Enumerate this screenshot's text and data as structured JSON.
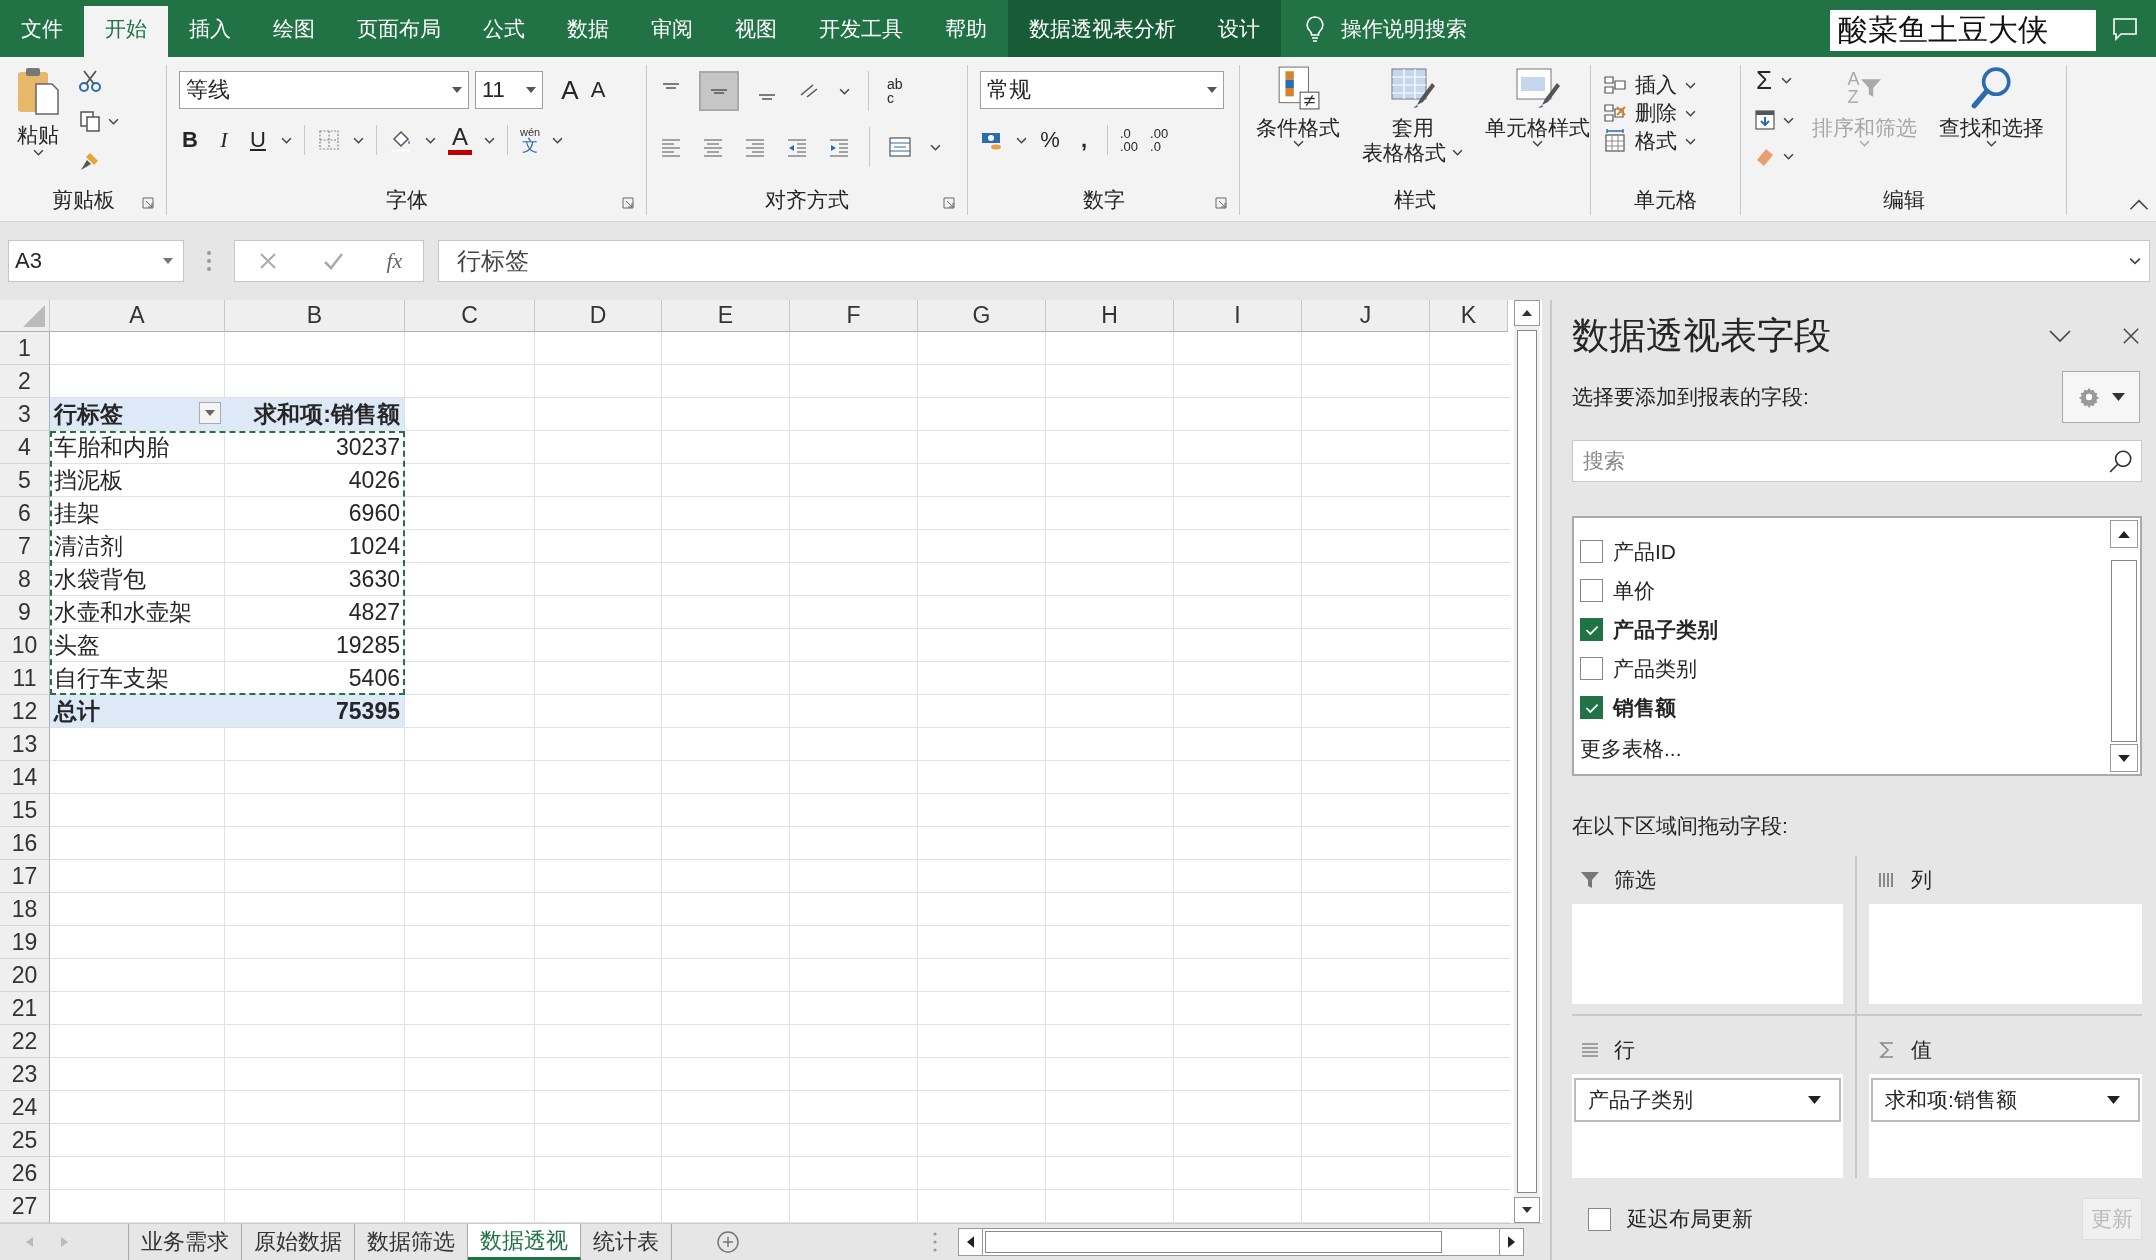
{
  "menu_tabs": [
    {
      "label": "文件",
      "selected": false,
      "contextual": false
    },
    {
      "label": "开始",
      "selected": true,
      "contextual": false
    },
    {
      "label": "插入",
      "selected": false,
      "contextual": false
    },
    {
      "label": "绘图",
      "selected": false,
      "contextual": false
    },
    {
      "label": "页面布局",
      "selected": false,
      "contextual": false
    },
    {
      "label": "公式",
      "selected": false,
      "contextual": false
    },
    {
      "label": "数据",
      "selected": false,
      "contextual": false
    },
    {
      "label": "审阅",
      "selected": false,
      "contextual": false
    },
    {
      "label": "视图",
      "selected": false,
      "contextual": false
    },
    {
      "label": "开发工具",
      "selected": false,
      "contextual": false
    },
    {
      "label": "帮助",
      "selected": false,
      "contextual": false
    },
    {
      "label": "数据透视表分析",
      "selected": false,
      "contextual": true
    },
    {
      "label": "设计",
      "selected": false,
      "contextual": true
    }
  ],
  "tell_me": "操作说明搜索",
  "user_name": "酸菜鱼土豆大侠",
  "ribbon": {
    "clipboard": {
      "paste": "粘贴",
      "label": "剪贴板"
    },
    "font": {
      "name": "等线",
      "size": "11",
      "grow": "A",
      "shrink": "A",
      "bold": "B",
      "italic": "I",
      "underline": "U",
      "font_color_glyph": "A",
      "phonetic_top": "wén",
      "phonetic_bottom": "文",
      "label": "字体"
    },
    "alignment": {
      "wrap_top": "ab",
      "wrap_bottom": "c",
      "label": "对齐方式"
    },
    "number": {
      "format": "常规",
      "percent": "%",
      "comma": ",",
      "increase_decimal": [
        ".0",
        ".00"
      ],
      "decrease_decimal": [
        ".00",
        ".0"
      ],
      "label": "数字"
    },
    "styles": {
      "buttons": [
        {
          "kind": "conditional",
          "lines": [
            "条件格式"
          ]
        },
        {
          "kind": "table",
          "lines": [
            "套用",
            "表格格式"
          ]
        },
        {
          "kind": "cell_style",
          "lines": [
            "单元格样式"
          ]
        }
      ],
      "label": "样式"
    },
    "cells": {
      "buttons": [
        {
          "kind": "insert",
          "label": "插入"
        },
        {
          "kind": "delete",
          "label": "删除"
        },
        {
          "kind": "format",
          "label": "格式"
        }
      ],
      "label": "单元格"
    },
    "editing": {
      "sum": "Σ",
      "sort_top": "A",
      "sort_bottom": "Z",
      "sort_label": "排序和筛选",
      "sort_disabled": true,
      "find_label": "查找和选择",
      "label": "编辑"
    }
  },
  "formula_bar": {
    "name_box": "A3",
    "fx": "fx",
    "content": "行标签"
  },
  "sheet": {
    "columns": [
      "A",
      "B",
      "C",
      "D",
      "E",
      "F",
      "G",
      "H",
      "I",
      "J",
      "K"
    ],
    "rows": [
      "1",
      "2",
      "3",
      "4",
      "5",
      "6",
      "7",
      "8",
      "9",
      "10",
      "11",
      "12",
      "13",
      "14",
      "15",
      "16",
      "17",
      "18",
      "19",
      "20",
      "21",
      "22",
      "23",
      "24",
      "25",
      "26",
      "27"
    ],
    "pivot": {
      "row_header": "行标签",
      "value_header": "求和项:销售额",
      "rows": [
        {
          "label": "车胎和内胎",
          "value": "30237"
        },
        {
          "label": "挡泥板",
          "value": "4026"
        },
        {
          "label": "挂架",
          "value": "6960"
        },
        {
          "label": "清洁剂",
          "value": "1024"
        },
        {
          "label": "水袋背包",
          "value": "3630"
        },
        {
          "label": "水壶和水壶架",
          "value": "4827"
        },
        {
          "label": "头盔",
          "value": "19285"
        },
        {
          "label": "自行车支架",
          "value": "5406"
        }
      ],
      "total_label": "总计",
      "total_value": "75395"
    }
  },
  "sheet_tabs": [
    {
      "label": "业务需求",
      "selected": false
    },
    {
      "label": "原始数据",
      "selected": false
    },
    {
      "label": "数据筛选",
      "selected": false
    },
    {
      "label": "数据透视",
      "selected": true
    },
    {
      "label": "统计表",
      "selected": false
    }
  ],
  "pivot_panel": {
    "title": "数据透视表字段",
    "prompt": "选择要添加到报表的字段:",
    "search_placeholder": "搜索",
    "fields": [
      {
        "label": "产品ID",
        "checked": false
      },
      {
        "label": "单价",
        "checked": false
      },
      {
        "label": "产品子类别",
        "checked": true
      },
      {
        "label": "产品类别",
        "checked": false
      },
      {
        "label": "销售额",
        "checked": true
      }
    ],
    "more_tables": "更多表格...",
    "areas_prompt": "在以下区域间拖动字段:",
    "areas": [
      {
        "kind": "filter",
        "label": "筛选"
      },
      {
        "kind": "columns",
        "label": "列"
      },
      {
        "kind": "rows",
        "label": "行",
        "items": [
          "产品子类别"
        ]
      },
      {
        "kind": "values",
        "label": "值",
        "items": [
          "求和项:销售额"
        ]
      }
    ],
    "defer": {
      "label": "延迟布局更新",
      "checked": false
    },
    "update_button": {
      "label": "更新",
      "disabled": true
    }
  }
}
